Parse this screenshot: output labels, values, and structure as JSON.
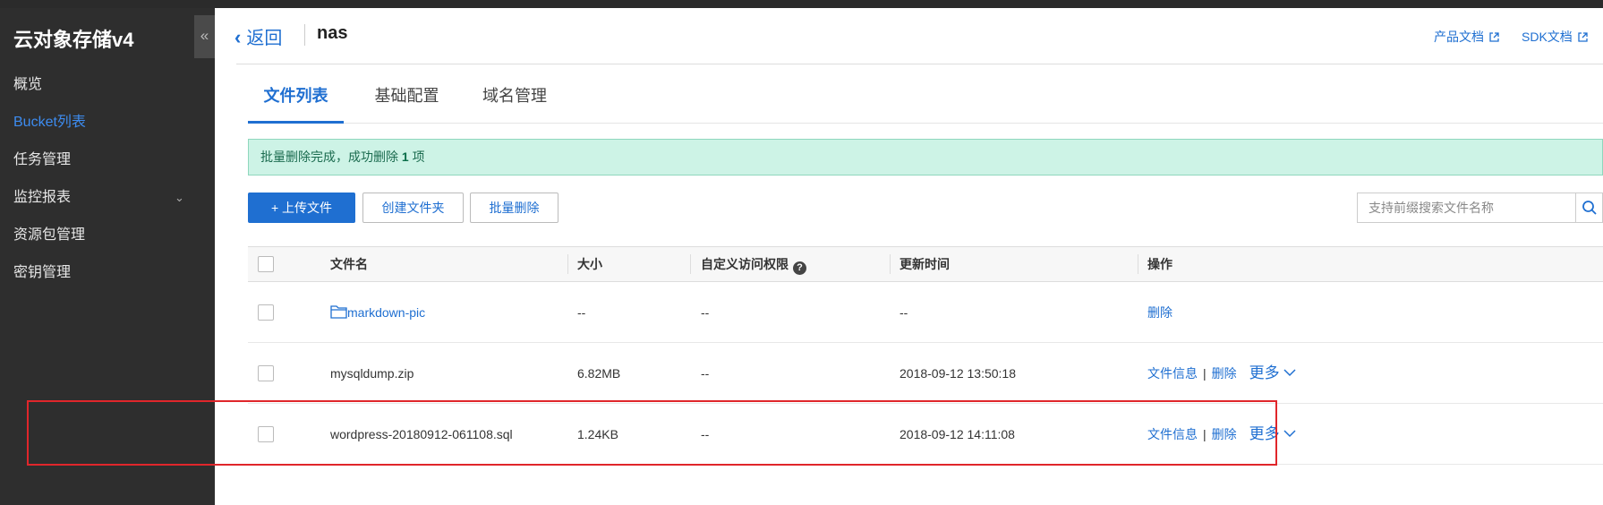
{
  "app": {
    "title": "云对象存储v4",
    "collapse_glyph": "«"
  },
  "sidebar": {
    "items": [
      {
        "label": "概览"
      },
      {
        "label": "Bucket列表"
      },
      {
        "label": "任务管理"
      },
      {
        "label": "监控报表",
        "chevron": "⌄"
      },
      {
        "label": "资源包管理"
      },
      {
        "label": "密钥管理"
      }
    ]
  },
  "header": {
    "back_label": "返回",
    "back_glyph": "‹",
    "bucket_name": "nas",
    "product_doc": "产品文档",
    "sdk_doc": "SDK文档"
  },
  "tabs": [
    {
      "label": "文件列表"
    },
    {
      "label": "基础配置"
    },
    {
      "label": "域名管理"
    }
  ],
  "alert": {
    "text_prefix": "批量删除完成，成功删除 ",
    "count": "1",
    "text_suffix": " 项"
  },
  "toolbar": {
    "upload_label": "+ 上传文件",
    "create_folder_label": "创建文件夹",
    "batch_delete_label": "批量删除",
    "search_placeholder": "支持前缀搜索文件名称"
  },
  "table": {
    "columns": [
      "文件名",
      "大小",
      "自定义访问权限",
      "更新时间",
      "操作"
    ],
    "help_glyph": "?",
    "rows": [
      {
        "name": "markdown-pic",
        "size": "--",
        "acl": "--",
        "updated": "--",
        "op1": "删除"
      },
      {
        "name": "mysqldump.zip",
        "size": "6.82MB",
        "acl": "--",
        "updated": "2018-09-12 13:50:18",
        "op1": "文件信息",
        "op2": "删除",
        "more": "更多"
      },
      {
        "name": "wordpress-20180912-061108.sql",
        "size": "1.24KB",
        "acl": "--",
        "updated": "2018-09-12 14:11:08",
        "op1": "文件信息",
        "op2": "删除",
        "more": "更多"
      }
    ],
    "op_separator": "|"
  },
  "colors": {
    "accent": "#1f6fd1",
    "sidebar_bg": "#2e2e2e",
    "alert_bg": "#cdf3e6",
    "highlight": "#e0262b"
  }
}
